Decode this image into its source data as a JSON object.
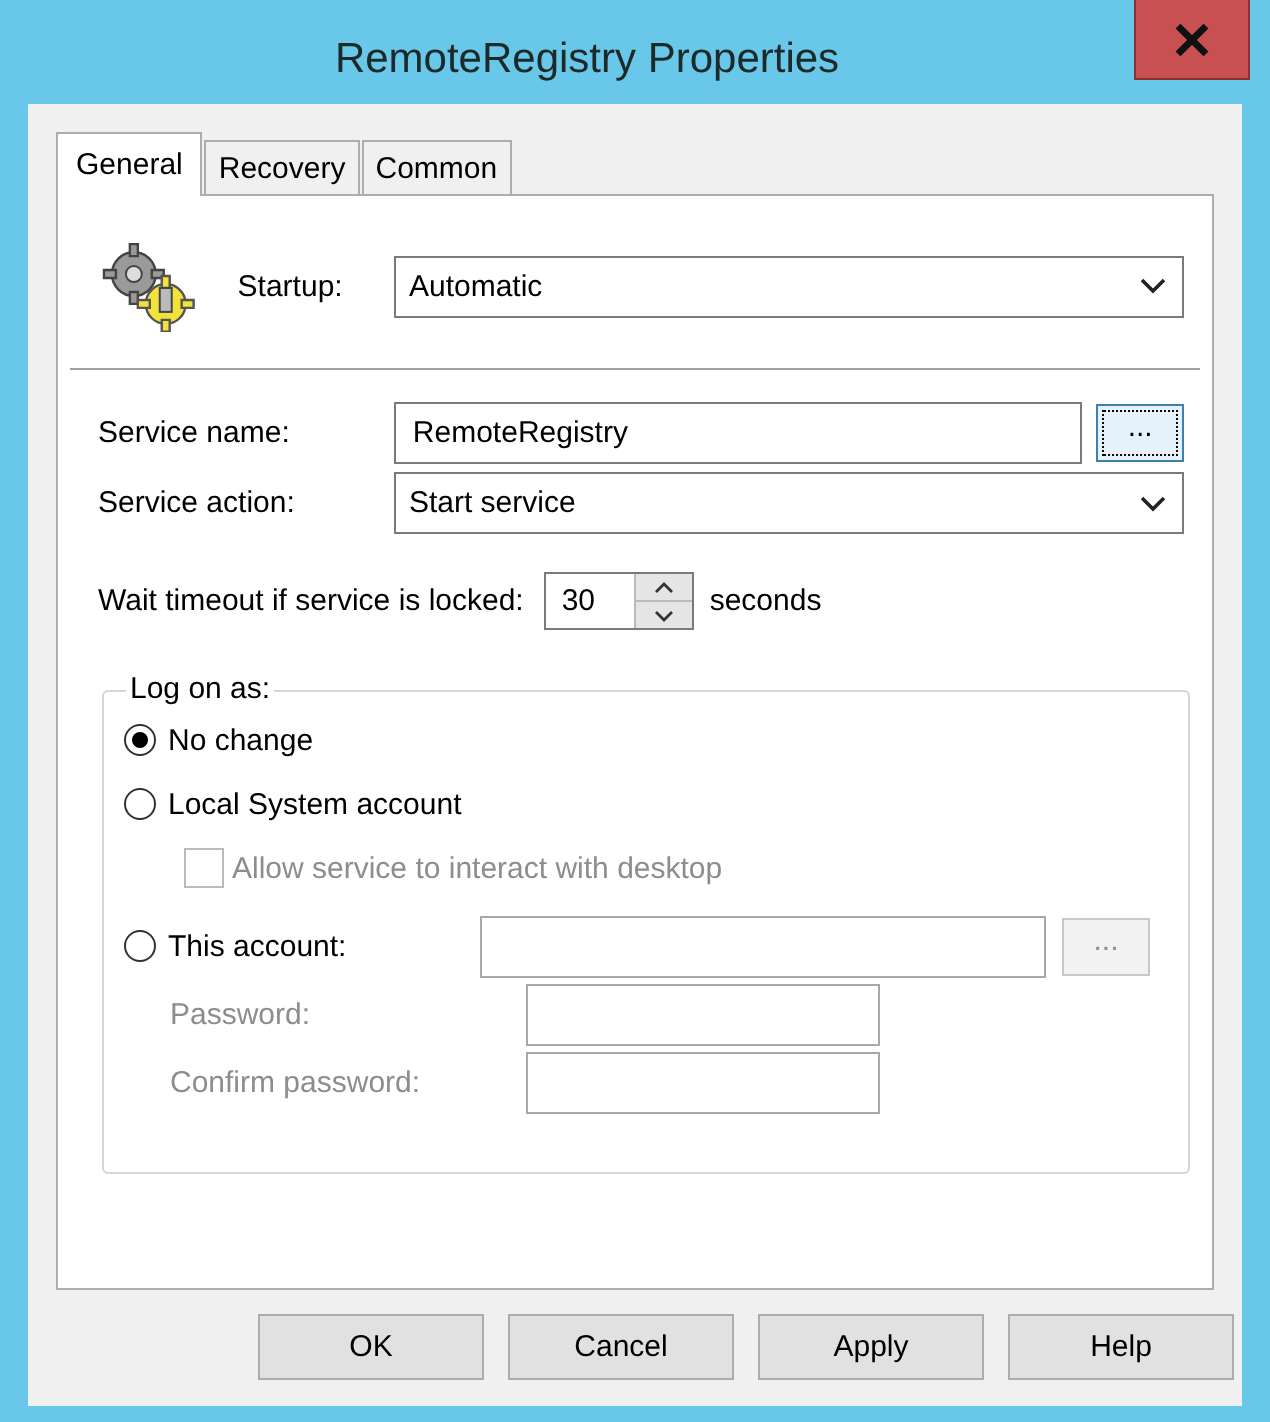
{
  "window": {
    "title": "RemoteRegistry Properties"
  },
  "tabs": [
    {
      "label": "General",
      "selected": true
    },
    {
      "label": "Recovery",
      "selected": false
    },
    {
      "label": "Common",
      "selected": false
    }
  ],
  "startup": {
    "label": "Startup:",
    "value": "Automatic"
  },
  "service_name": {
    "label": "Service name:",
    "value": "RemoteRegistry",
    "browse": "..."
  },
  "service_action": {
    "label": "Service action:",
    "value": "Start service"
  },
  "wait_timeout": {
    "label": "Wait timeout if service is locked:",
    "value": "30",
    "unit": "seconds"
  },
  "log_on": {
    "title": "Log on as:",
    "options": [
      {
        "kind": "radio",
        "label": "No change",
        "selected": true
      },
      {
        "kind": "radio",
        "label": "Local System account",
        "selected": false
      },
      {
        "kind": "checkbox",
        "label": "Allow service to interact with desktop",
        "checked": false,
        "disabled": true
      },
      {
        "kind": "radio",
        "label": "This account:",
        "selected": false
      }
    ],
    "account_browse": {
      "label": "...",
      "disabled": true
    },
    "password": {
      "label": "Password:",
      "disabled": true
    },
    "confirm_password": {
      "label": "Confirm password:",
      "disabled": true
    }
  },
  "buttons": [
    {
      "label": "OK"
    },
    {
      "label": "Cancel"
    },
    {
      "label": "Apply"
    },
    {
      "label": "Help"
    }
  ]
}
